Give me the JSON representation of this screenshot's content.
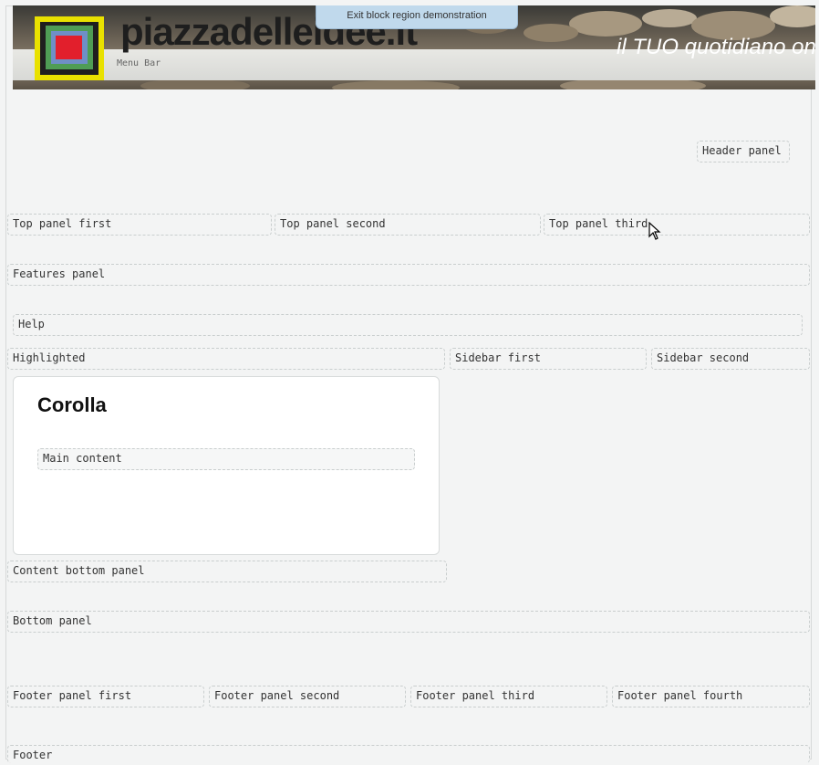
{
  "header": {
    "site_name": "piazzadelleidee.it",
    "slogan": "il TUO quotidiano online",
    "menu_bar": "Menu Bar",
    "exit_button": "Exit block region demonstration"
  },
  "regions": {
    "header_panel": "Header panel",
    "top_panel_first": "Top panel first",
    "top_panel_second": "Top panel second",
    "top_panel_third": "Top panel third",
    "features_panel": "Features panel",
    "help": "Help",
    "highlighted": "Highlighted",
    "sidebar_first": "Sidebar first",
    "sidebar_second": "Sidebar second",
    "main_content": "Main content",
    "content_bottom_panel": "Content bottom panel",
    "bottom_panel": "Bottom panel",
    "footer_panel_first": "Footer panel first",
    "footer_panel_second": "Footer panel second",
    "footer_panel_third": "Footer panel third",
    "footer_panel_fourth": "Footer panel fourth",
    "footer": "Footer"
  },
  "main": {
    "title": "Corolla"
  },
  "colors": {
    "background": "#f3f4f4",
    "exit_button_bg": "#c0d9ec",
    "logo_red": "#e21f2c",
    "logo_yellow": "#e9e100",
    "logo_green": "#4f9d55"
  },
  "icons": {
    "cursor": "mouse-pointer-icon",
    "logo": "site-logo"
  }
}
